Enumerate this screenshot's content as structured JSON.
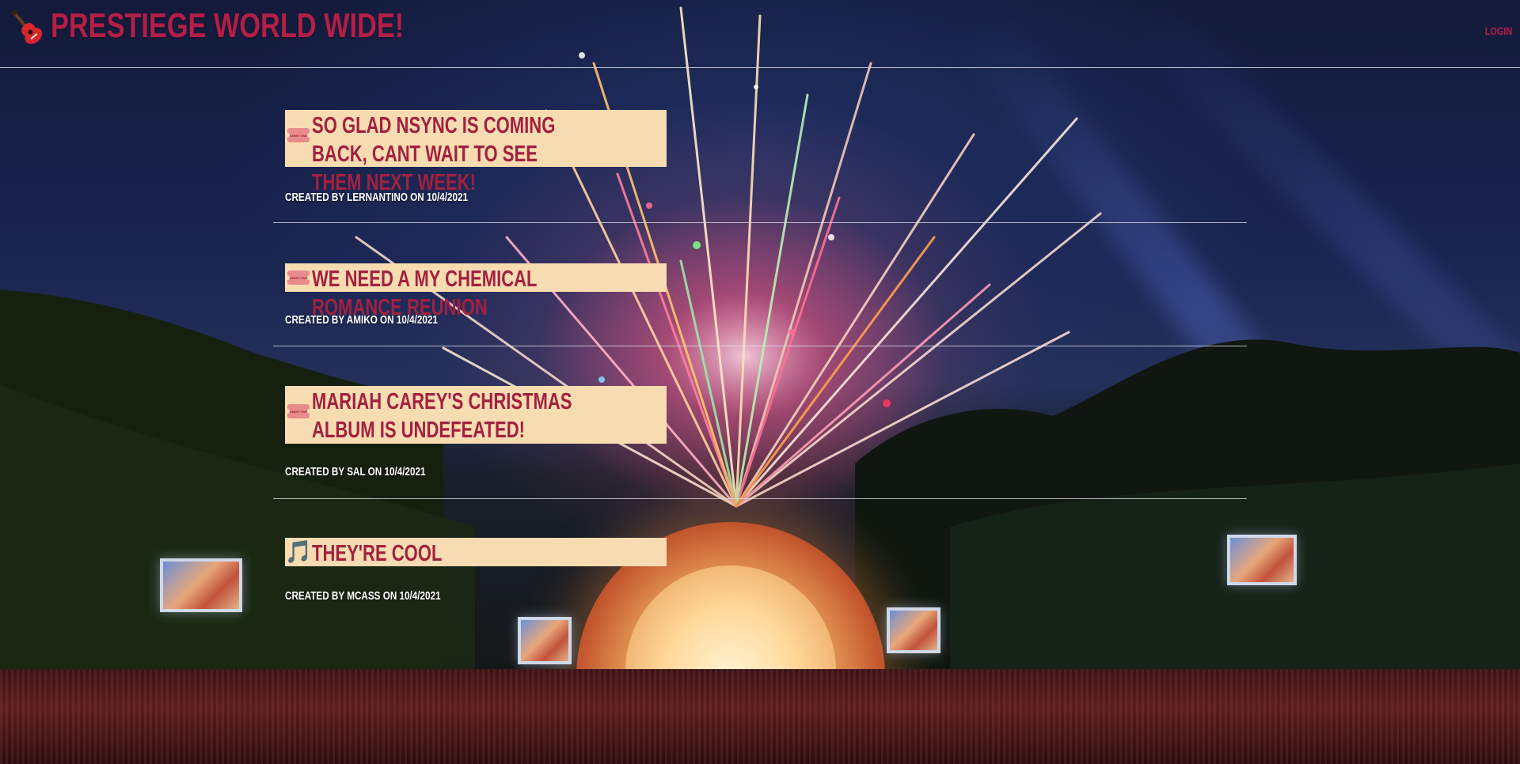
{
  "header": {
    "brand_icon": "guitar-icon",
    "title": "PRESTIEGE WORLD WIDE!",
    "login_label": "LOGIN"
  },
  "colors": {
    "accent": "#a2213f",
    "title_box": "#f7dcb2",
    "meta_text": "#ffffff"
  },
  "posts": [
    {
      "icon": "ticket-icon",
      "icon_text": "ADMIT ONE",
      "title": "SO GLAD NSYNC IS COMING BACK, CANT WAIT TO SEE THEM NEXT WEEK!",
      "meta": "CREATED BY LERNANTINO ON 10/4/2021"
    },
    {
      "icon": "ticket-icon",
      "icon_text": "ADMIT ONE",
      "title": "WE NEED A MY CHEMICAL ROMANCE REUNION",
      "meta": "CREATED BY AMIKO ON 10/4/2021"
    },
    {
      "icon": "ticket-icon",
      "icon_text": "ADMIT ONE",
      "title": "MARIAH CAREY'S CHRISTMAS ALBUM IS UNDEFEATED!",
      "meta": "CREATED BY SAL ON 10/4/2021"
    },
    {
      "icon": "music-note-icon",
      "icon_glyph": "🎵",
      "title": "THEY'RE COOL",
      "meta": "CREATED BY MCASS ON 10/4/2021"
    }
  ]
}
